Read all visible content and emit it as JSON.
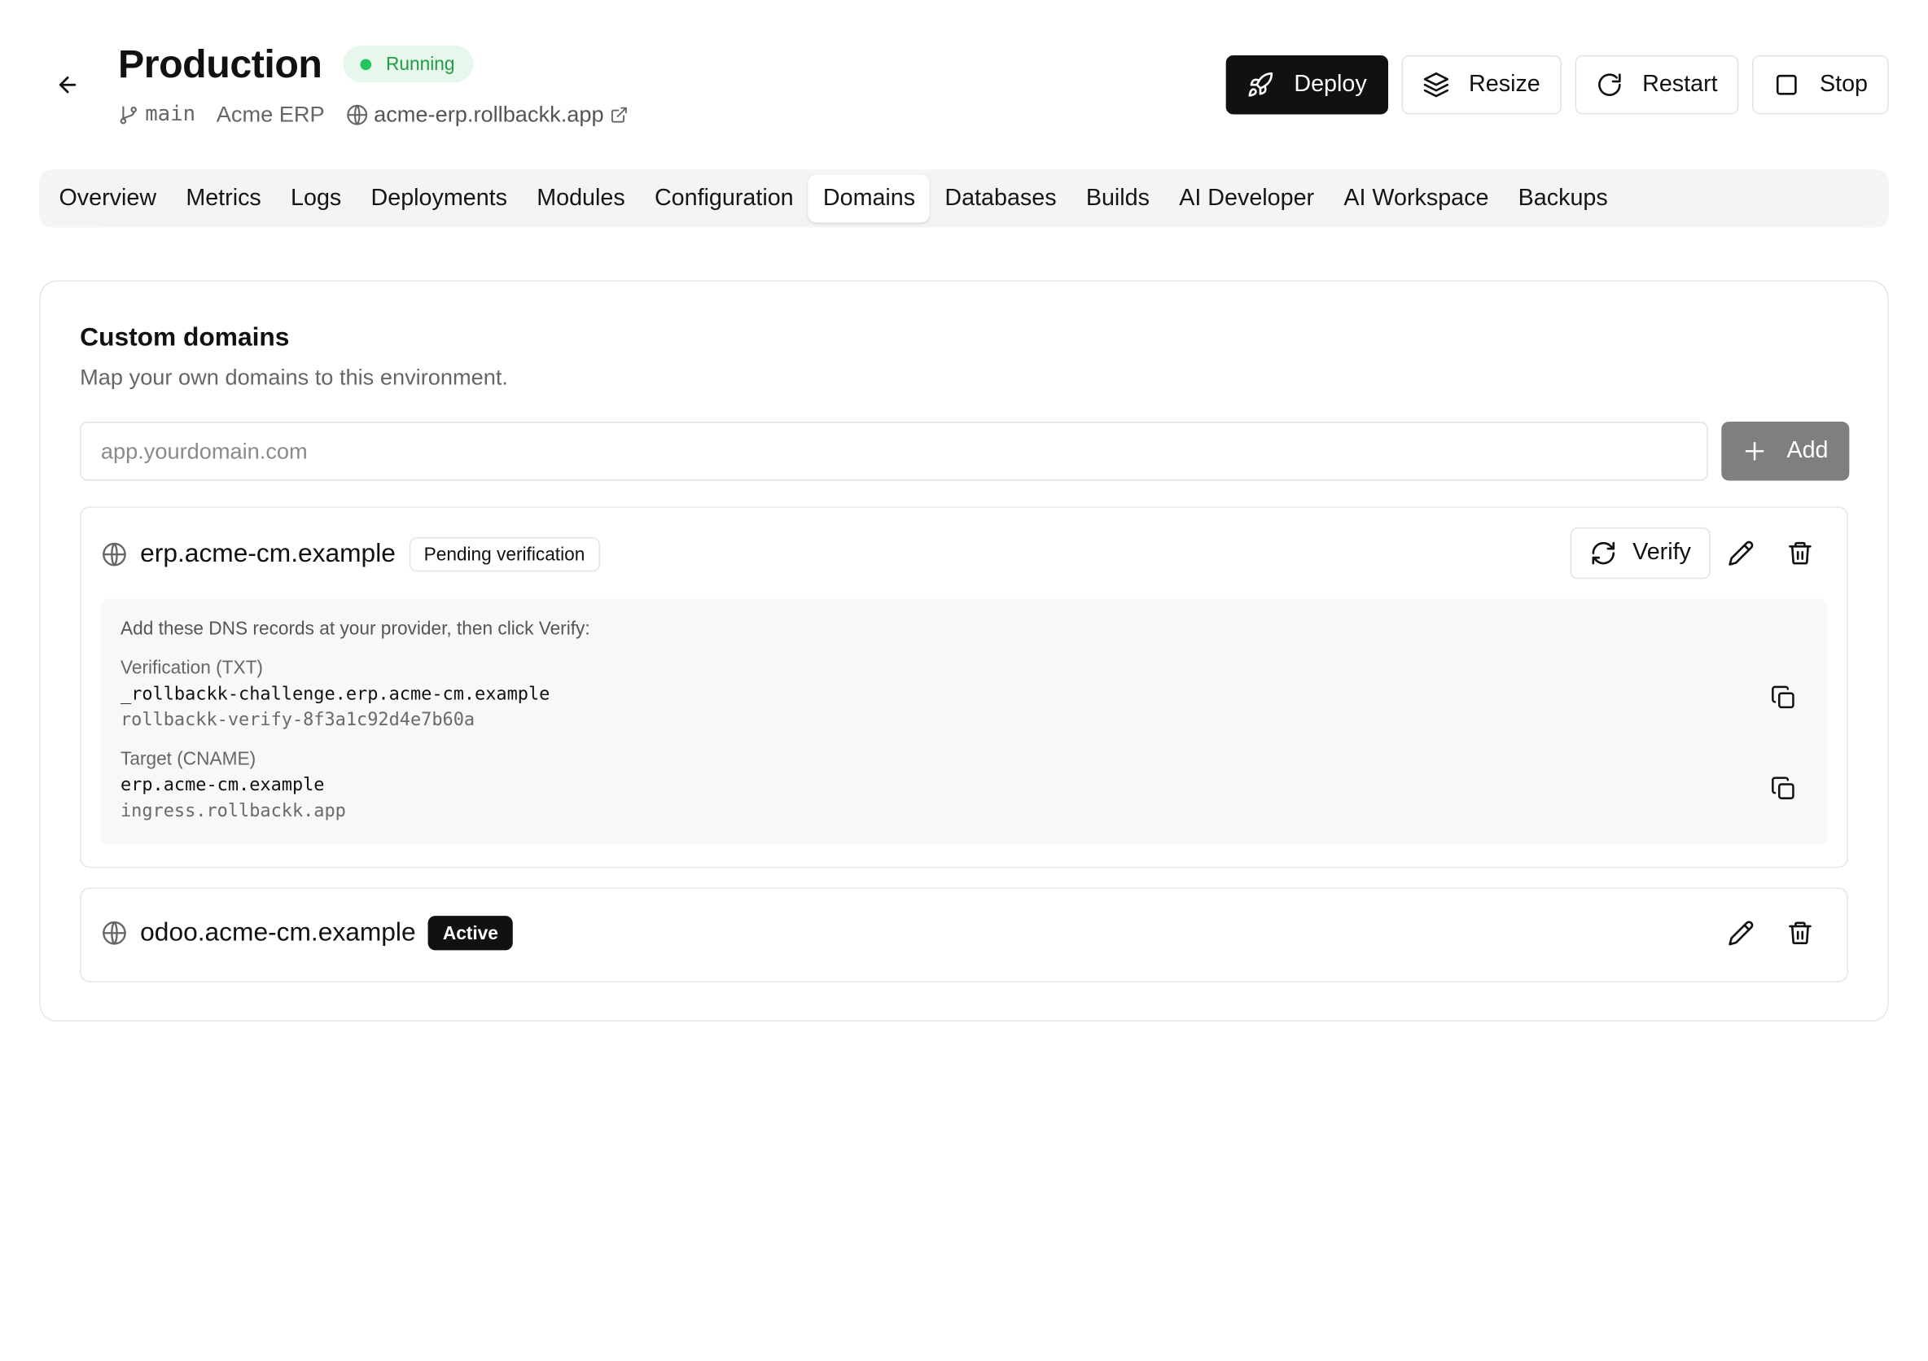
{
  "header": {
    "title": "Production",
    "status": "Running",
    "branch": "main",
    "project": "Acme ERP",
    "url": "acme-erp.rollbackk.app"
  },
  "actions": {
    "deploy": "Deploy",
    "resize": "Resize",
    "restart": "Restart",
    "stop": "Stop"
  },
  "tabs": [
    "Overview",
    "Metrics",
    "Logs",
    "Deployments",
    "Modules",
    "Configuration",
    "Domains",
    "Databases",
    "Builds",
    "AI Developer",
    "AI Workspace",
    "Backups"
  ],
  "active_tab": "Domains",
  "custom_domains": {
    "title": "Custom domains",
    "description": "Map your own domains to this environment.",
    "input_placeholder": "app.yourdomain.com",
    "add_label": "Add",
    "domains": [
      {
        "name": "erp.acme-cm.example",
        "badge": "Pending verification",
        "verify_label": "Verify",
        "dns": {
          "intro": "Add these DNS records at your provider, then click Verify:",
          "records": [
            {
              "label": "Verification (TXT)",
              "name": "_rollbackk-challenge.erp.acme-cm.example",
              "value": "rollbackk-verify-8f3a1c92d4e7b60a"
            },
            {
              "label": "Target (CNAME)",
              "name": "erp.acme-cm.example",
              "value": "ingress.rollbackk.app"
            }
          ]
        }
      },
      {
        "name": "odoo.acme-cm.example",
        "badge": "Active"
      }
    ]
  },
  "colors": {
    "status_green": "#1f9d45",
    "status_bg": "#e8f7ec",
    "primary": "#111111",
    "add_button": "#7f7f7f"
  },
  "icons": {
    "back": "arrow-left-icon",
    "branch": "git-branch-icon",
    "url": "globe-icon",
    "external": "external-link-icon",
    "deploy": "rocket-icon",
    "resize": "layers-icon",
    "restart": "rotate-cw-icon",
    "stop": "square-icon",
    "add": "plus-icon",
    "verify": "refresh-icon",
    "edit": "pencil-icon",
    "delete": "trash-icon",
    "copy": "copy-icon"
  }
}
